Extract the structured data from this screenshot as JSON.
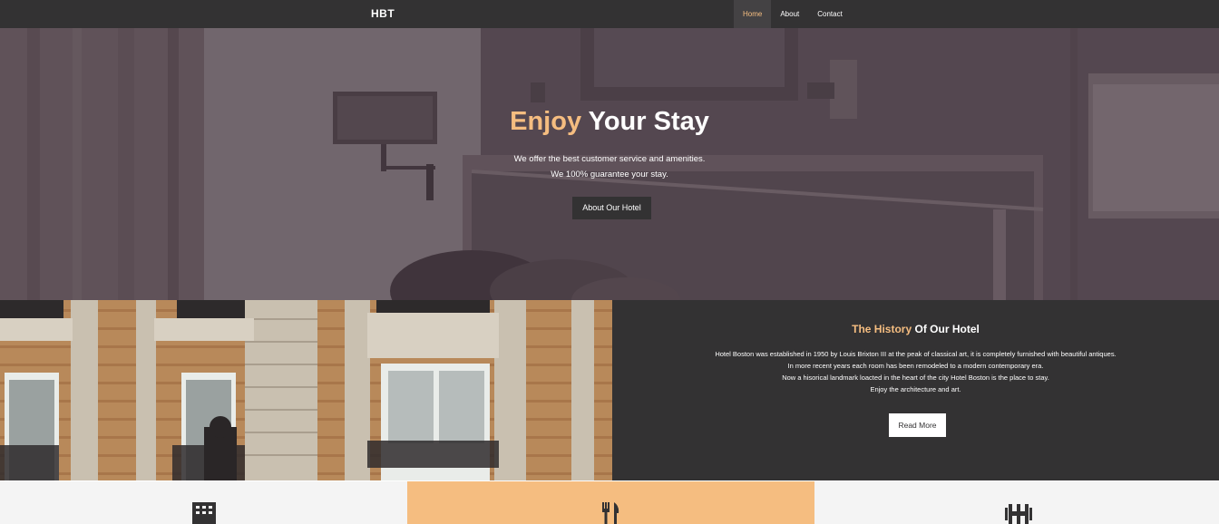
{
  "navbar": {
    "brand": "HBT",
    "items": [
      {
        "label": "Home",
        "active": true
      },
      {
        "label": "About",
        "active": false
      },
      {
        "label": "Contact",
        "active": false
      }
    ]
  },
  "hero": {
    "title_accent": "Enjoy",
    "title_rest": "Your Stay",
    "line1": "We offer the best customer service and amenities.",
    "line2": "We 100% guarantee your stay.",
    "button_label": "About Our Hotel"
  },
  "history": {
    "title_accent": "The History",
    "title_rest": "Of Our Hotel",
    "paragraphs": [
      "Hotel Boston was established in 1950 by Louis Brixton III at the peak of classical art, it is completely furnished with beautiful antiques.",
      "In more recent years each room has been remodeled to a modern contemporary era.",
      "Now a hisorical landmark loacted in the heart of the city Hotel Boston is the place to stay.",
      "Enjoy the architecture and art."
    ],
    "button_label": "Read More"
  },
  "features": [
    {
      "icon": "building-icon"
    },
    {
      "icon": "utensils-icon"
    },
    {
      "icon": "dumbbell-icon"
    }
  ],
  "colors": {
    "accent": "#f5bd80",
    "dark": "#333233",
    "light": "#f4f4f4"
  }
}
